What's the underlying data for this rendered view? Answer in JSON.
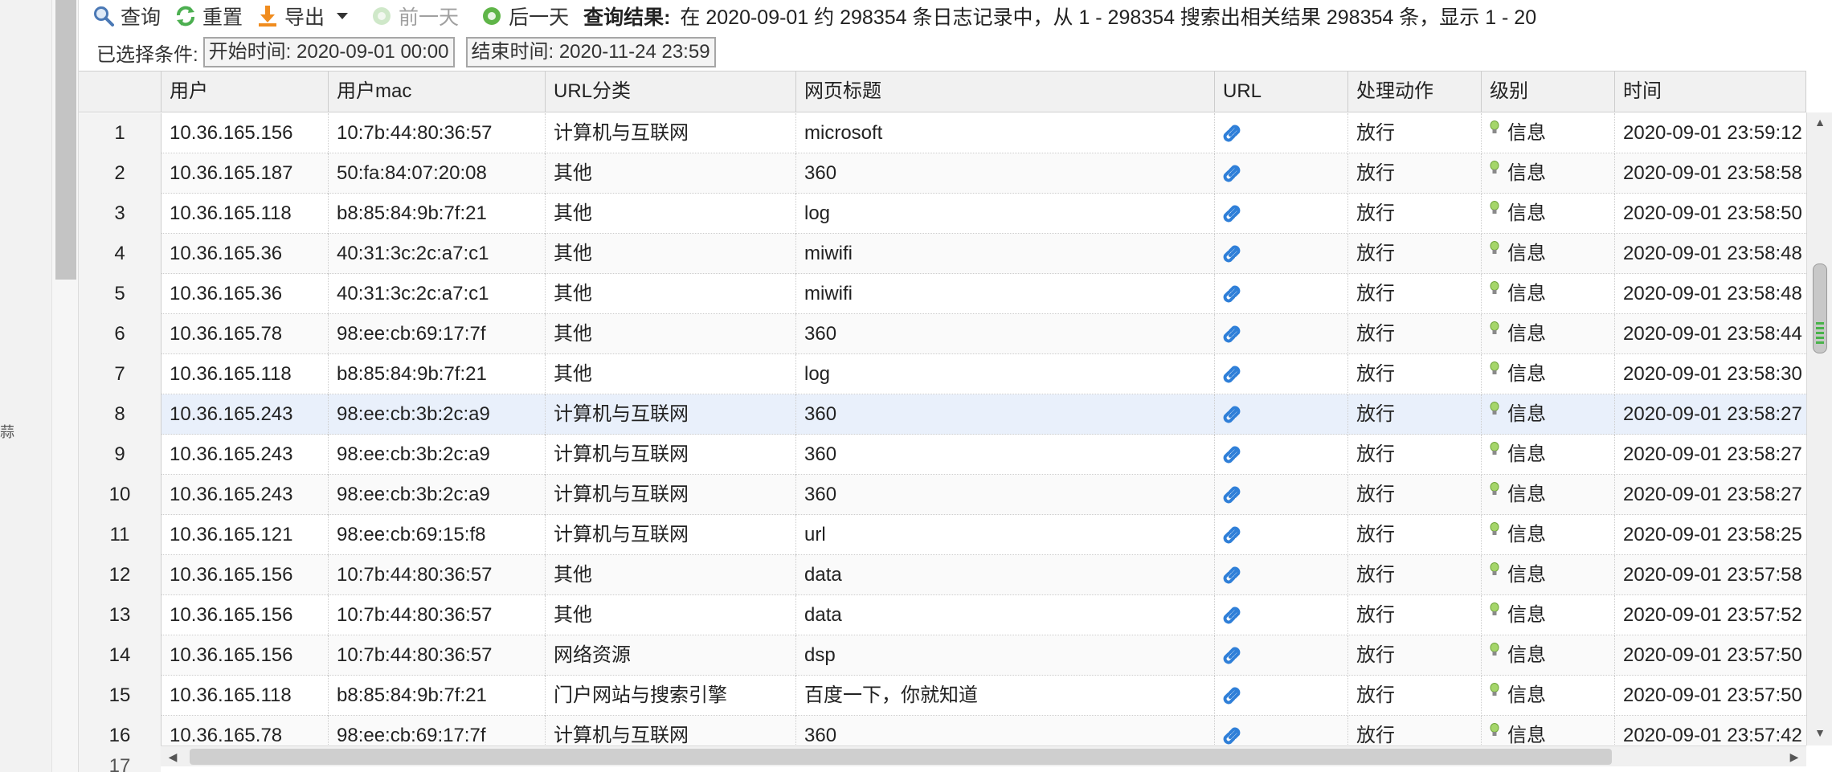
{
  "left_panel": {
    "mark": "蒜"
  },
  "toolbar": {
    "query_label": "查询",
    "reset_label": "重置",
    "export_label": "导出",
    "prev_day_label": "前一天",
    "next_day_label": "后一天",
    "result_label": "查询结果:",
    "result_text": "在 2020-09-01 约 298354 条日志记录中，从 1 - 298354 搜索出相关结果 298354 条，显示 1 - 20"
  },
  "conditions": {
    "label": "已选择条件:",
    "start": "开始时间: 2020-09-01 00:00",
    "end": "结束时间: 2020-11-24 23:59"
  },
  "table": {
    "columns": [
      "",
      "用户",
      "用户mac",
      "URL分类",
      "网页标题",
      "URL",
      "处理动作",
      "级别",
      "时间"
    ],
    "rows": [
      {
        "n": "1",
        "user": "10.36.165.156",
        "mac": "10:7b:44:80:36:57",
        "category": "计算机与互联网",
        "title": "microsoft",
        "action": "放行",
        "level": "信息",
        "time": "2020-09-01 23:59:12"
      },
      {
        "n": "2",
        "user": "10.36.165.187",
        "mac": "50:fa:84:07:20:08",
        "category": "其他",
        "title": "360",
        "action": "放行",
        "level": "信息",
        "time": "2020-09-01 23:58:58"
      },
      {
        "n": "3",
        "user": "10.36.165.118",
        "mac": "b8:85:84:9b:7f:21",
        "category": "其他",
        "title": "log",
        "action": "放行",
        "level": "信息",
        "time": "2020-09-01 23:58:50"
      },
      {
        "n": "4",
        "user": "10.36.165.36",
        "mac": "40:31:3c:2c:a7:c1",
        "category": "其他",
        "title": "miwifi",
        "action": "放行",
        "level": "信息",
        "time": "2020-09-01 23:58:48"
      },
      {
        "n": "5",
        "user": "10.36.165.36",
        "mac": "40:31:3c:2c:a7:c1",
        "category": "其他",
        "title": "miwifi",
        "action": "放行",
        "level": "信息",
        "time": "2020-09-01 23:58:48"
      },
      {
        "n": "6",
        "user": "10.36.165.78",
        "mac": "98:ee:cb:69:17:7f",
        "category": "其他",
        "title": "360",
        "action": "放行",
        "level": "信息",
        "time": "2020-09-01 23:58:44"
      },
      {
        "n": "7",
        "user": "10.36.165.118",
        "mac": "b8:85:84:9b:7f:21",
        "category": "其他",
        "title": "log",
        "action": "放行",
        "level": "信息",
        "time": "2020-09-01 23:58:30"
      },
      {
        "n": "8",
        "user": "10.36.165.243",
        "mac": "98:ee:cb:3b:2c:a9",
        "category": "计算机与互联网",
        "title": "360",
        "action": "放行",
        "level": "信息",
        "time": "2020-09-01 23:58:27"
      },
      {
        "n": "9",
        "user": "10.36.165.243",
        "mac": "98:ee:cb:3b:2c:a9",
        "category": "计算机与互联网",
        "title": "360",
        "action": "放行",
        "level": "信息",
        "time": "2020-09-01 23:58:27"
      },
      {
        "n": "10",
        "user": "10.36.165.243",
        "mac": "98:ee:cb:3b:2c:a9",
        "category": "计算机与互联网",
        "title": "360",
        "action": "放行",
        "level": "信息",
        "time": "2020-09-01 23:58:27"
      },
      {
        "n": "11",
        "user": "10.36.165.121",
        "mac": "98:ee:cb:69:15:f8",
        "category": "计算机与互联网",
        "title": "url",
        "action": "放行",
        "level": "信息",
        "time": "2020-09-01 23:58:25"
      },
      {
        "n": "12",
        "user": "10.36.165.156",
        "mac": "10:7b:44:80:36:57",
        "category": "其他",
        "title": "data",
        "action": "放行",
        "level": "信息",
        "time": "2020-09-01 23:57:58"
      },
      {
        "n": "13",
        "user": "10.36.165.156",
        "mac": "10:7b:44:80:36:57",
        "category": "其他",
        "title": "data",
        "action": "放行",
        "level": "信息",
        "time": "2020-09-01 23:57:52"
      },
      {
        "n": "14",
        "user": "10.36.165.156",
        "mac": "10:7b:44:80:36:57",
        "category": "网络资源",
        "title": "dsp",
        "action": "放行",
        "level": "信息",
        "time": "2020-09-01 23:57:50"
      },
      {
        "n": "15",
        "user": "10.36.165.118",
        "mac": "b8:85:84:9b:7f:21",
        "category": "门户网站与搜索引擎",
        "title": "百度一下，你就知道",
        "action": "放行",
        "level": "信息",
        "time": "2020-09-01 23:57:50"
      },
      {
        "n": "16",
        "user": "10.36.165.78",
        "mac": "98:ee:cb:69:17:7f",
        "category": "计算机与互联网",
        "title": "360",
        "action": "放行",
        "level": "信息",
        "time": "2020-09-01 23:57:42"
      }
    ],
    "next_row_number": "17",
    "highlighted_row": 8
  },
  "icons": {
    "query": "search-icon",
    "reset": "refresh-icon",
    "export": "download-icon",
    "prev_day": "arrow-left-circle-icon",
    "next_day": "arrow-right-circle-icon",
    "url": "link-icon",
    "level": "lightbulb-icon"
  },
  "colors": {
    "link_blue": "#2f7fd8",
    "bulb_green": "#8bc34a",
    "export_orange": "#f08c1e",
    "refresh_green": "#4caf50",
    "row_highlight": "#e9f0fb"
  }
}
